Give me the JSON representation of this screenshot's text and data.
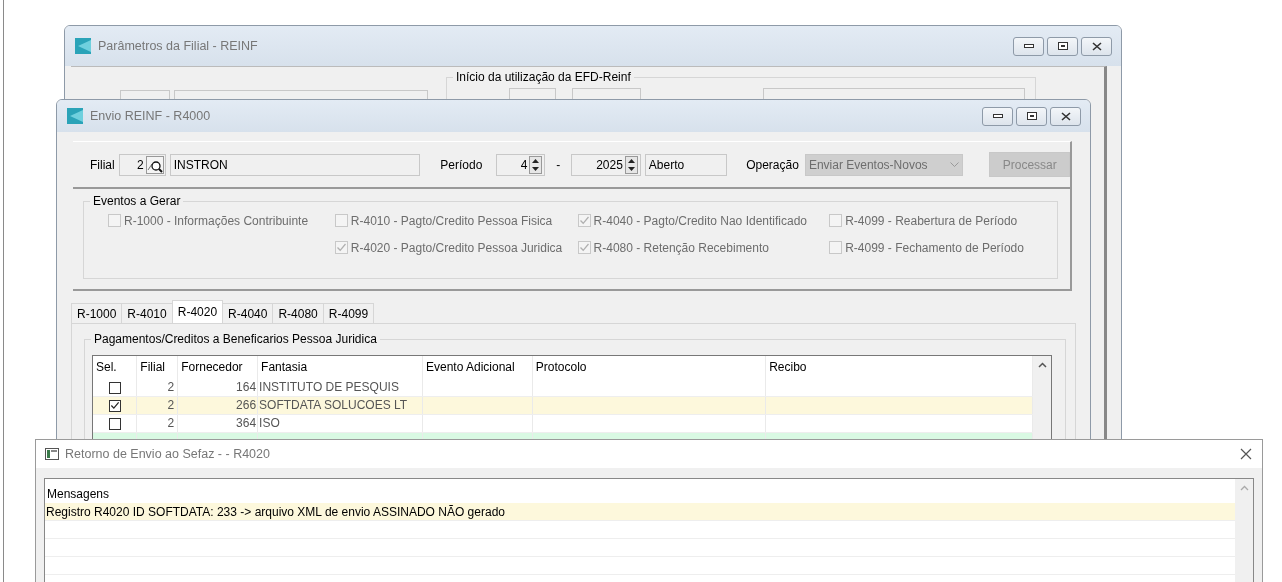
{
  "background_window": {
    "title": "Parâmetros da Filial - REINF",
    "group_label": "Início da utilização da EFD-Reinf"
  },
  "envio_window": {
    "title": "Envio REINF - R4000",
    "filial_label": "Filial",
    "filial_code": "2",
    "filial_name": "INSTRON",
    "periodo_label": "Período",
    "periodo_month": "4",
    "periodo_separator": "-",
    "periodo_year": "2025",
    "periodo_status": "Aberto",
    "operacao_label": "Operação",
    "operacao": {
      "value": "Enviar Eventos-Novos",
      "disabled": true
    },
    "process_button": {
      "label": "Processar",
      "disabled": true
    },
    "eventos": {
      "label": "Eventos a Gerar",
      "columns": [
        {
          "items": [
            {
              "label": "R-1000 - Informações Contribuinte",
              "checked": false,
              "disabled": true
            }
          ]
        },
        {
          "items": [
            {
              "label": "R-4010 - Pagto/Credito Pessoa Fisica",
              "checked": false,
              "disabled": true
            },
            {
              "label": "R-4020 - Pagto/Credito Pessoa Juridica",
              "checked": true,
              "disabled": true
            }
          ]
        },
        {
          "items": [
            {
              "label": "R-4040 - Pagto/Credito Nao Identificado",
              "checked": true,
              "disabled": true
            },
            {
              "label": "R-4080 - Retenção Recebimento",
              "checked": true,
              "disabled": true
            }
          ]
        },
        {
          "items": [
            {
              "label": "R-4099 - Reabertura de Período",
              "checked": false,
              "disabled": true
            },
            {
              "label": "R-4099 - Fechamento de Período",
              "checked": false,
              "disabled": true
            }
          ]
        }
      ]
    },
    "tabs": [
      {
        "label": "R-1000",
        "selected": false
      },
      {
        "label": "R-4010",
        "selected": false
      },
      {
        "label": "R-4020",
        "selected": true
      },
      {
        "label": "R-4040",
        "selected": false
      },
      {
        "label": "R-4080",
        "selected": false
      },
      {
        "label": "R-4099",
        "selected": false
      }
    ],
    "grid": {
      "label": "Pagamentos/Creditos a Beneficarios Pessoa Juridica",
      "columns": [
        "Sel.",
        "Filial",
        "Fornecedor",
        "Fantasia",
        "Evento Adicional",
        "Protocolo",
        "Recibo"
      ],
      "rows": [
        {
          "checked": false,
          "filial": "2",
          "fornecedor": "164",
          "fantasia": "INSTITUTO DE PESQUIS",
          "color": "#ffffff"
        },
        {
          "checked": true,
          "filial": "2",
          "fornecedor": "266",
          "fantasia": "SOFTDATA SOLUCOES LT",
          "color": "#fdf8dc"
        },
        {
          "checked": false,
          "filial": "2",
          "fornecedor": "364",
          "fantasia": "ISO",
          "color": "#ffffff"
        },
        {
          "color": "#d9f9e3"
        }
      ]
    }
  },
  "retorno_window": {
    "title": "Retorno de Envio ao Sefaz -  - R4020",
    "column": "Mensagens",
    "messages": [
      {
        "text": "Registro R4020 ID SOFTDATA: 233 -> arquivo XML de envio ASSINADO NÃO gerado",
        "selected": true
      }
    ]
  }
}
